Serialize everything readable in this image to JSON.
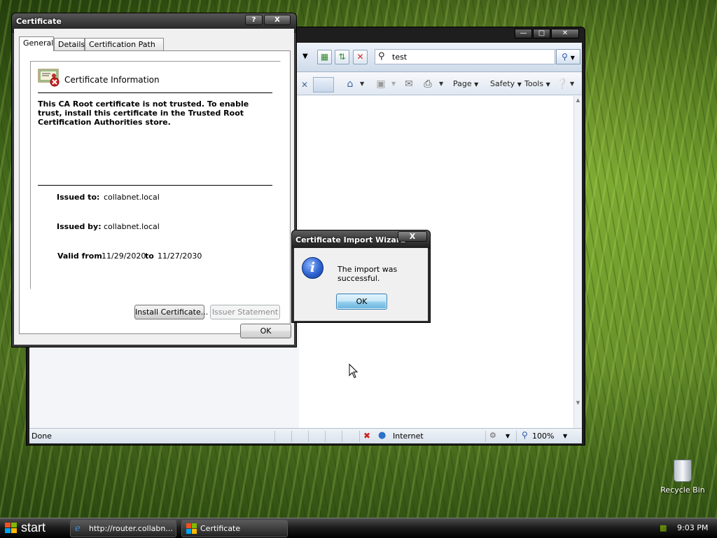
{
  "desktop": {
    "recycle_bin": "Recycle Bin"
  },
  "browser": {
    "search_value": "test",
    "cmd": {
      "page": "Page",
      "safety": "Safety",
      "tools": "Tools"
    },
    "status": {
      "done": "Done",
      "zone": "Internet",
      "zoom": "100%"
    }
  },
  "cert_dialog": {
    "title": "Certificate",
    "help_glyph": "?",
    "close_glyph": "X",
    "tabs": [
      "General",
      "Details",
      "Certification Path"
    ],
    "info_title": "Certificate Information",
    "warning": "This CA Root certificate is not trusted. To enable trust, install this certificate in the Trusted Root Certification Authorities store.",
    "issued_to_label": "Issued to:",
    "issued_to_value": "collabnet.local",
    "issued_by_label": "Issued by:",
    "issued_by_value": "collabnet.local",
    "valid_from_label": "Valid from",
    "valid_from_value": "11/29/2020",
    "valid_to_label": "to",
    "valid_to_value": "11/27/2030",
    "install_button": "Install Certificate...",
    "issuer_button": "Issuer Statement",
    "ok_button": "OK"
  },
  "import_wizard": {
    "title": "Certificate Import Wizard",
    "close_glyph": "X",
    "message": "The import was successful.",
    "ok_button": "OK"
  },
  "taskbar": {
    "start": "start",
    "tasks": [
      {
        "label": "http://router.collabn..."
      },
      {
        "label": "Certificate"
      }
    ],
    "clock": "9:03 PM"
  }
}
